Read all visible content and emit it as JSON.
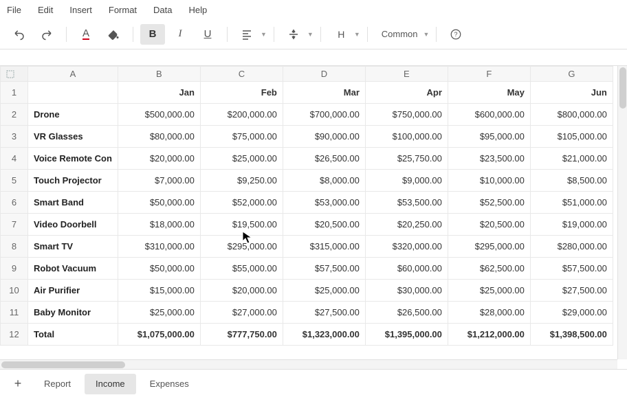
{
  "menu": {
    "items": [
      "File",
      "Edit",
      "Insert",
      "Format",
      "Data",
      "Help"
    ]
  },
  "toolbar": {
    "font_combo": "Common"
  },
  "columns": [
    "A",
    "B",
    "C",
    "D",
    "E",
    "F",
    "G"
  ],
  "header_row": [
    "",
    "Jan",
    "Feb",
    "Mar",
    "Apr",
    "May",
    "Jun"
  ],
  "rows": [
    {
      "label": "Drone",
      "cells": [
        "$500,000.00",
        "$200,000.00",
        "$700,000.00",
        "$750,000.00",
        "$600,000.00",
        "$800,000.00"
      ]
    },
    {
      "label": "VR Glasses",
      "cells": [
        "$80,000.00",
        "$75,000.00",
        "$90,000.00",
        "$100,000.00",
        "$95,000.00",
        "$105,000.00"
      ]
    },
    {
      "label": "Voice Remote Con",
      "cells": [
        "$20,000.00",
        "$25,000.00",
        "$26,500.00",
        "$25,750.00",
        "$23,500.00",
        "$21,000.00"
      ]
    },
    {
      "label": "Touch Projector",
      "cells": [
        "$7,000.00",
        "$9,250.00",
        "$8,000.00",
        "$9,000.00",
        "$10,000.00",
        "$8,500.00"
      ]
    },
    {
      "label": "Smart Band",
      "cells": [
        "$50,000.00",
        "$52,000.00",
        "$53,000.00",
        "$53,500.00",
        "$52,500.00",
        "$51,000.00"
      ]
    },
    {
      "label": "Video Doorbell",
      "cells": [
        "$18,000.00",
        "$19,500.00",
        "$20,500.00",
        "$20,250.00",
        "$20,500.00",
        "$19,000.00"
      ]
    },
    {
      "label": "Smart TV",
      "cells": [
        "$310,000.00",
        "$295,000.00",
        "$315,000.00",
        "$320,000.00",
        "$295,000.00",
        "$280,000.00"
      ]
    },
    {
      "label": "Robot Vacuum",
      "cells": [
        "$50,000.00",
        "$55,000.00",
        "$57,500.00",
        "$60,000.00",
        "$62,500.00",
        "$57,500.00"
      ]
    },
    {
      "label": "Air Purifier",
      "cells": [
        "$15,000.00",
        "$20,000.00",
        "$25,000.00",
        "$30,000.00",
        "$25,000.00",
        "$27,500.00"
      ]
    },
    {
      "label": "Baby Monitor",
      "cells": [
        "$25,000.00",
        "$27,000.00",
        "$27,500.00",
        "$26,500.00",
        "$28,000.00",
        "$29,000.00"
      ]
    }
  ],
  "total_row": {
    "label": "Total",
    "cells": [
      "$1,075,000.00",
      "$777,750.00",
      "$1,323,000.00",
      "$1,395,000.00",
      "$1,212,000.00",
      "$1,398,500.00"
    ]
  },
  "tabs": {
    "items": [
      "Report",
      "Income",
      "Expenses"
    ],
    "active": 1
  }
}
